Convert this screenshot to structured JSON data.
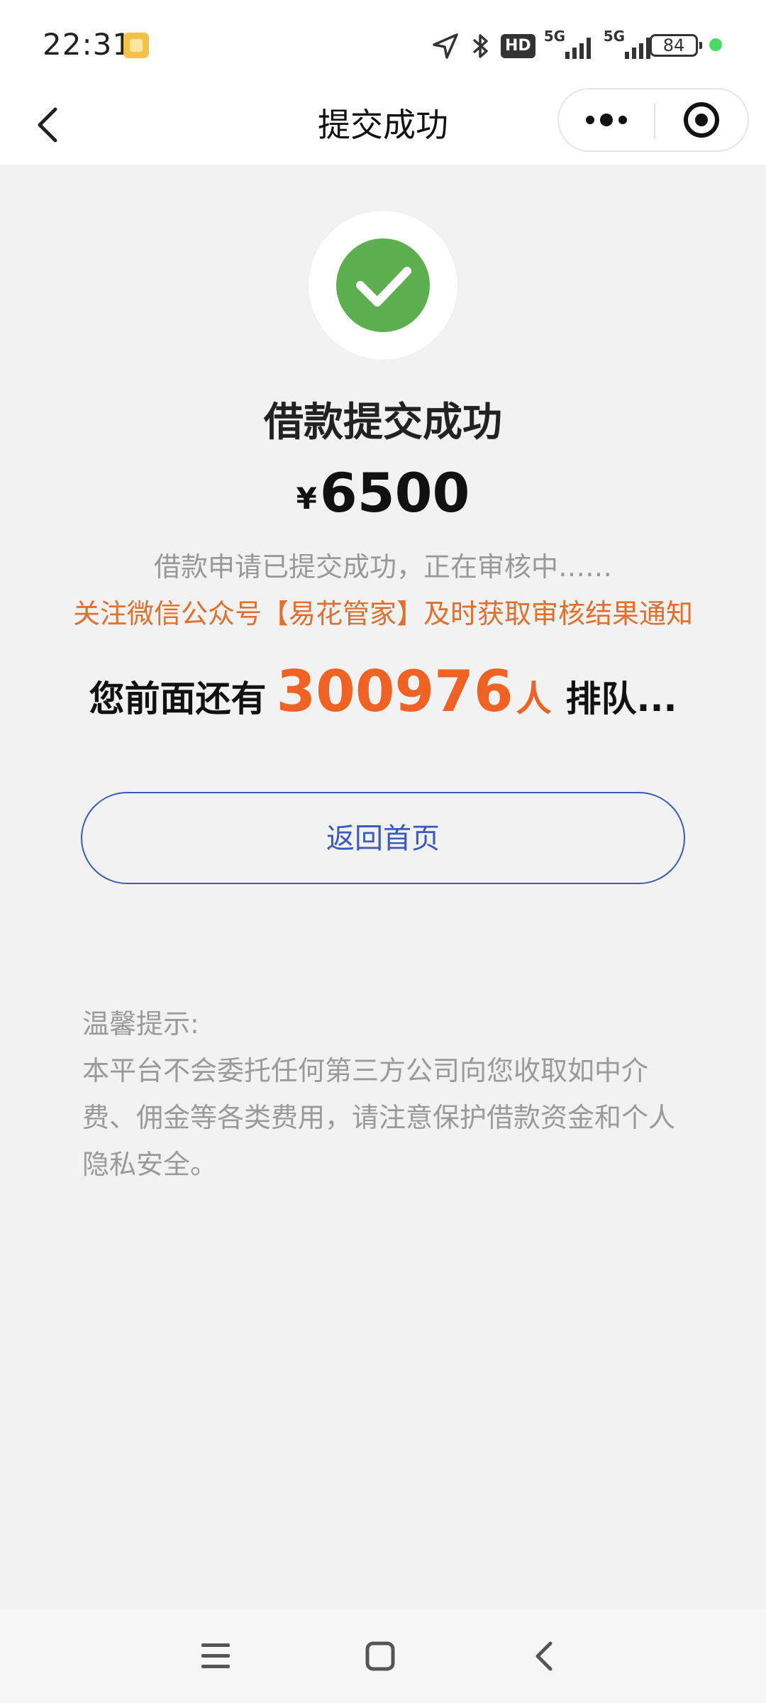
{
  "status_bar": {
    "time": "22:31",
    "hd_label": "HD",
    "network_1": "5G",
    "network_2": "5G",
    "battery": "84"
  },
  "nav": {
    "title": "提交成功"
  },
  "result": {
    "title": "借款提交成功",
    "currency": "¥",
    "amount": "6500",
    "status_text": "借款申请已提交成功，正在审核中……",
    "notice_text": "关注微信公众号【易花管家】及时获取审核结果通知",
    "queue_prefix": "您前面还有",
    "queue_count": "300976",
    "queue_unit": "人",
    "queue_suffix": "排队..."
  },
  "actions": {
    "home_label": "返回首页"
  },
  "tips": {
    "heading": "温馨提示:",
    "body": "本平台不会委托任何第三方公司向您收取如中介费、佣金等各类费用，请注意保护借款资金和个人隐私安全。"
  },
  "colors": {
    "success_green": "#5cae4e",
    "accent_orange": "#f06224",
    "notice_orange": "#e0702e",
    "button_blue": "#3a5bbd"
  },
  "icons": {
    "back": "chevron-left-icon",
    "more": "more-dots-icon",
    "close": "target-close-icon",
    "success": "check-circle-icon",
    "sys_menu": "menu-lines-icon",
    "sys_home": "square-home-icon",
    "sys_back": "chevron-left-icon"
  }
}
